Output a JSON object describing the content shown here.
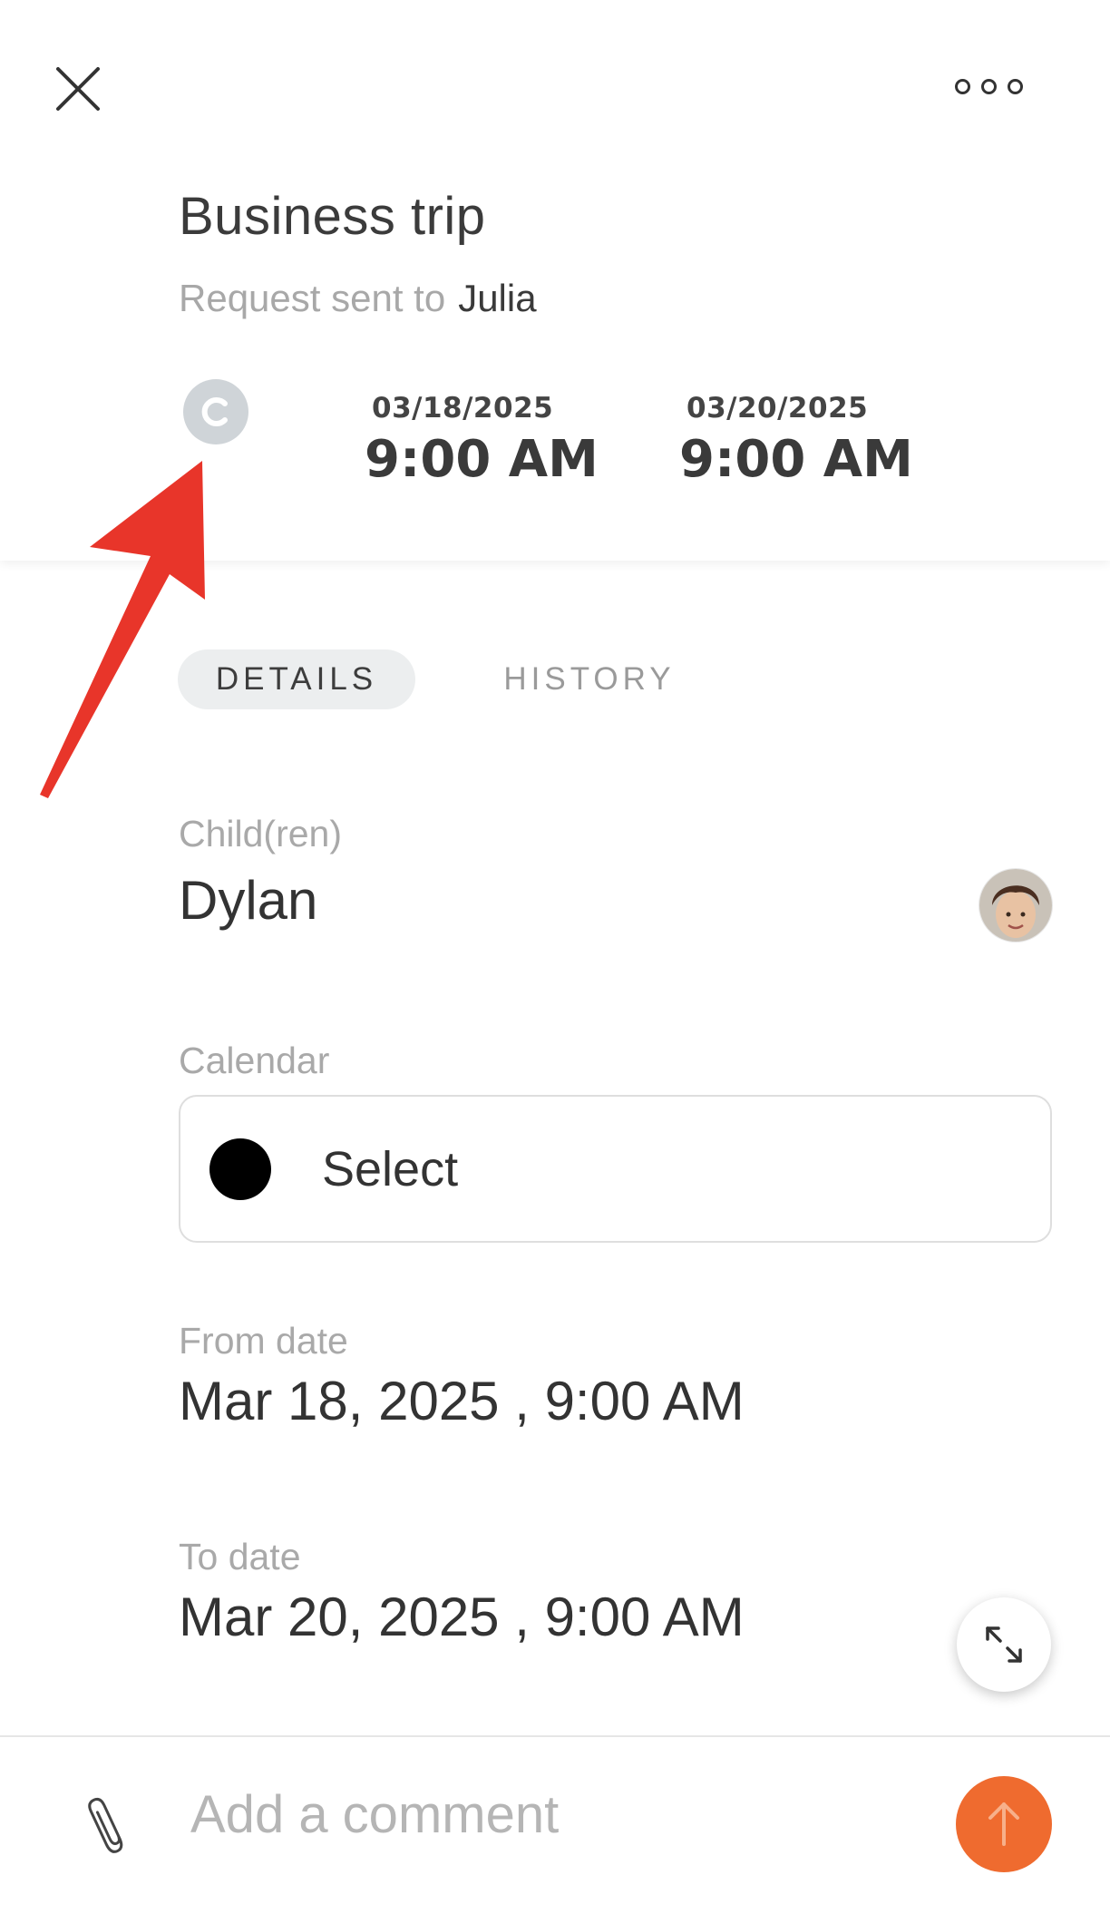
{
  "header": {
    "title": "Business trip",
    "subtitle_label": "Request sent to",
    "recipient": "Julia",
    "from": {
      "date": "03/18/2025",
      "time": "9:00 AM"
    },
    "to": {
      "date": "03/20/2025",
      "time": "9:00 AM"
    },
    "status_icon": "pending-icon",
    "close_icon": "close-icon",
    "more_icon": "more-icon"
  },
  "tabs": [
    {
      "label": "DETAILS",
      "active": true
    },
    {
      "label": "HISTORY",
      "active": false
    }
  ],
  "details": {
    "children_label": "Child(ren)",
    "children_value": "Dylan",
    "calendar_label": "Calendar",
    "calendar_value": "Select",
    "calendar_color": "#000000",
    "from_label": "From date",
    "from_value": "Mar 18, 2025 , 9:00 AM",
    "to_label": "To date",
    "to_value": "Mar 20, 2025 , 9:00 AM"
  },
  "comment": {
    "placeholder": "Add a comment"
  },
  "colors": {
    "send_button": "#ef6b2f",
    "annotation_arrow": "#e8352a",
    "status_icon": "#cfd4d8"
  }
}
